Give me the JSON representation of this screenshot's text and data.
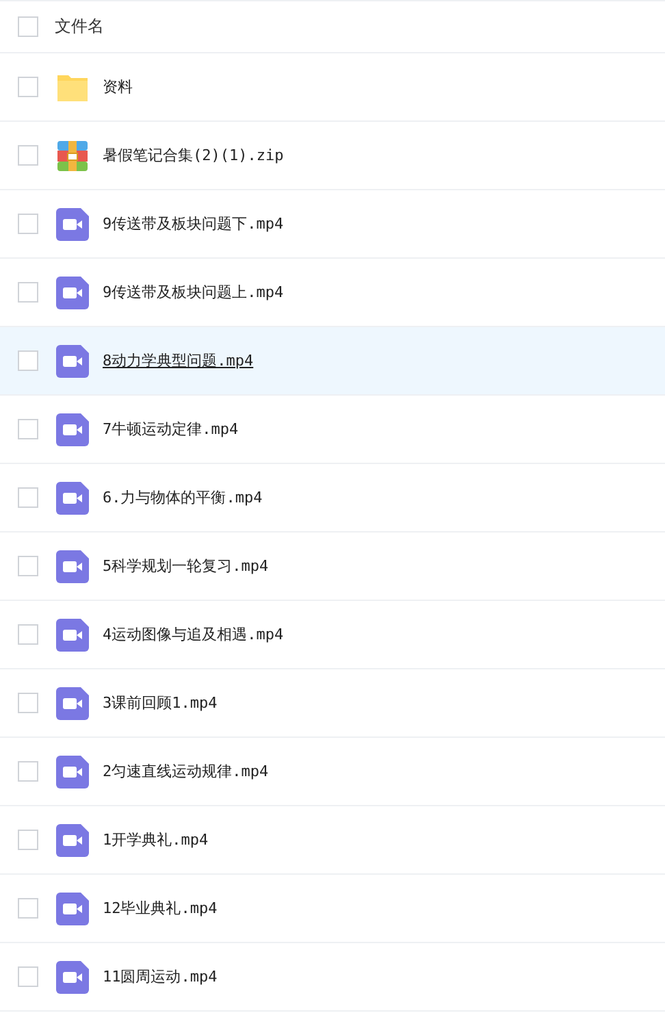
{
  "header": {
    "label": "文件名",
    "checked": false
  },
  "files": [
    {
      "kind": "folder",
      "name": "资料",
      "checked": false,
      "hovered": false
    },
    {
      "kind": "zip",
      "name": "暑假笔记合集(2)(1).zip",
      "checked": false,
      "hovered": false
    },
    {
      "kind": "video",
      "name": "9传送带及板块问题下.mp4",
      "checked": false,
      "hovered": false
    },
    {
      "kind": "video",
      "name": "9传送带及板块问题上.mp4",
      "checked": false,
      "hovered": false
    },
    {
      "kind": "video",
      "name": "8动力学典型问题.mp4",
      "checked": false,
      "hovered": true
    },
    {
      "kind": "video",
      "name": "7牛顿运动定律.mp4",
      "checked": false,
      "hovered": false
    },
    {
      "kind": "video",
      "name": "6.力与物体的平衡.mp4",
      "checked": false,
      "hovered": false
    },
    {
      "kind": "video",
      "name": "5科学规划一轮复习.mp4",
      "checked": false,
      "hovered": false
    },
    {
      "kind": "video",
      "name": "4运动图像与追及相遇.mp4",
      "checked": false,
      "hovered": false
    },
    {
      "kind": "video",
      "name": "3课前回顾1.mp4",
      "checked": false,
      "hovered": false
    },
    {
      "kind": "video",
      "name": "2匀速直线运动规律.mp4",
      "checked": false,
      "hovered": false
    },
    {
      "kind": "video",
      "name": "1开学典礼.mp4",
      "checked": false,
      "hovered": false
    },
    {
      "kind": "video",
      "name": "12毕业典礼.mp4",
      "checked": false,
      "hovered": false
    },
    {
      "kind": "video",
      "name": "11圆周运动.mp4",
      "checked": false,
      "hovered": false
    }
  ]
}
